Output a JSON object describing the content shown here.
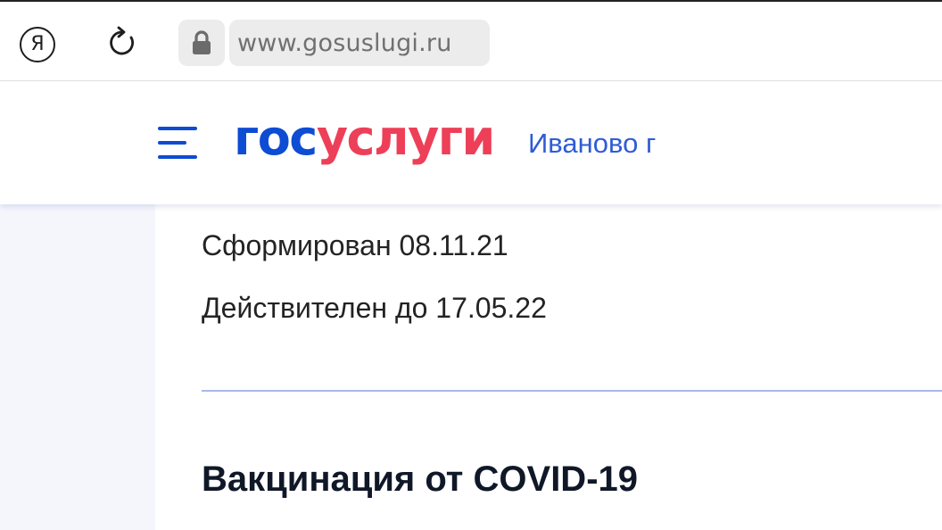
{
  "browser": {
    "yandex_button": {
      "icon": "yandex-icon",
      "glyph": "Я"
    },
    "reload_button": {
      "icon": "reload-icon"
    },
    "lock_button": {
      "icon": "lock-icon"
    },
    "address_bar": {
      "url": "www.gosuslugi.ru"
    }
  },
  "header": {
    "menu_icon": "hamburger-menu-icon",
    "logo": {
      "part_a": "гос",
      "part_b": "услуги"
    },
    "location": "Иваново г"
  },
  "certificate": {
    "formed": "Сформирован 08.11.21",
    "valid_until": "Действителен до 17.05.22"
  },
  "vaccination": {
    "title": "Вакцинация от COVID-19"
  },
  "colors": {
    "brand_blue": "#0d4cd3",
    "brand_red": "#ee3f58",
    "link_blue": "#2f5cd6",
    "divider": "#a9b8ea",
    "side_bg": "#f4f6fc"
  }
}
